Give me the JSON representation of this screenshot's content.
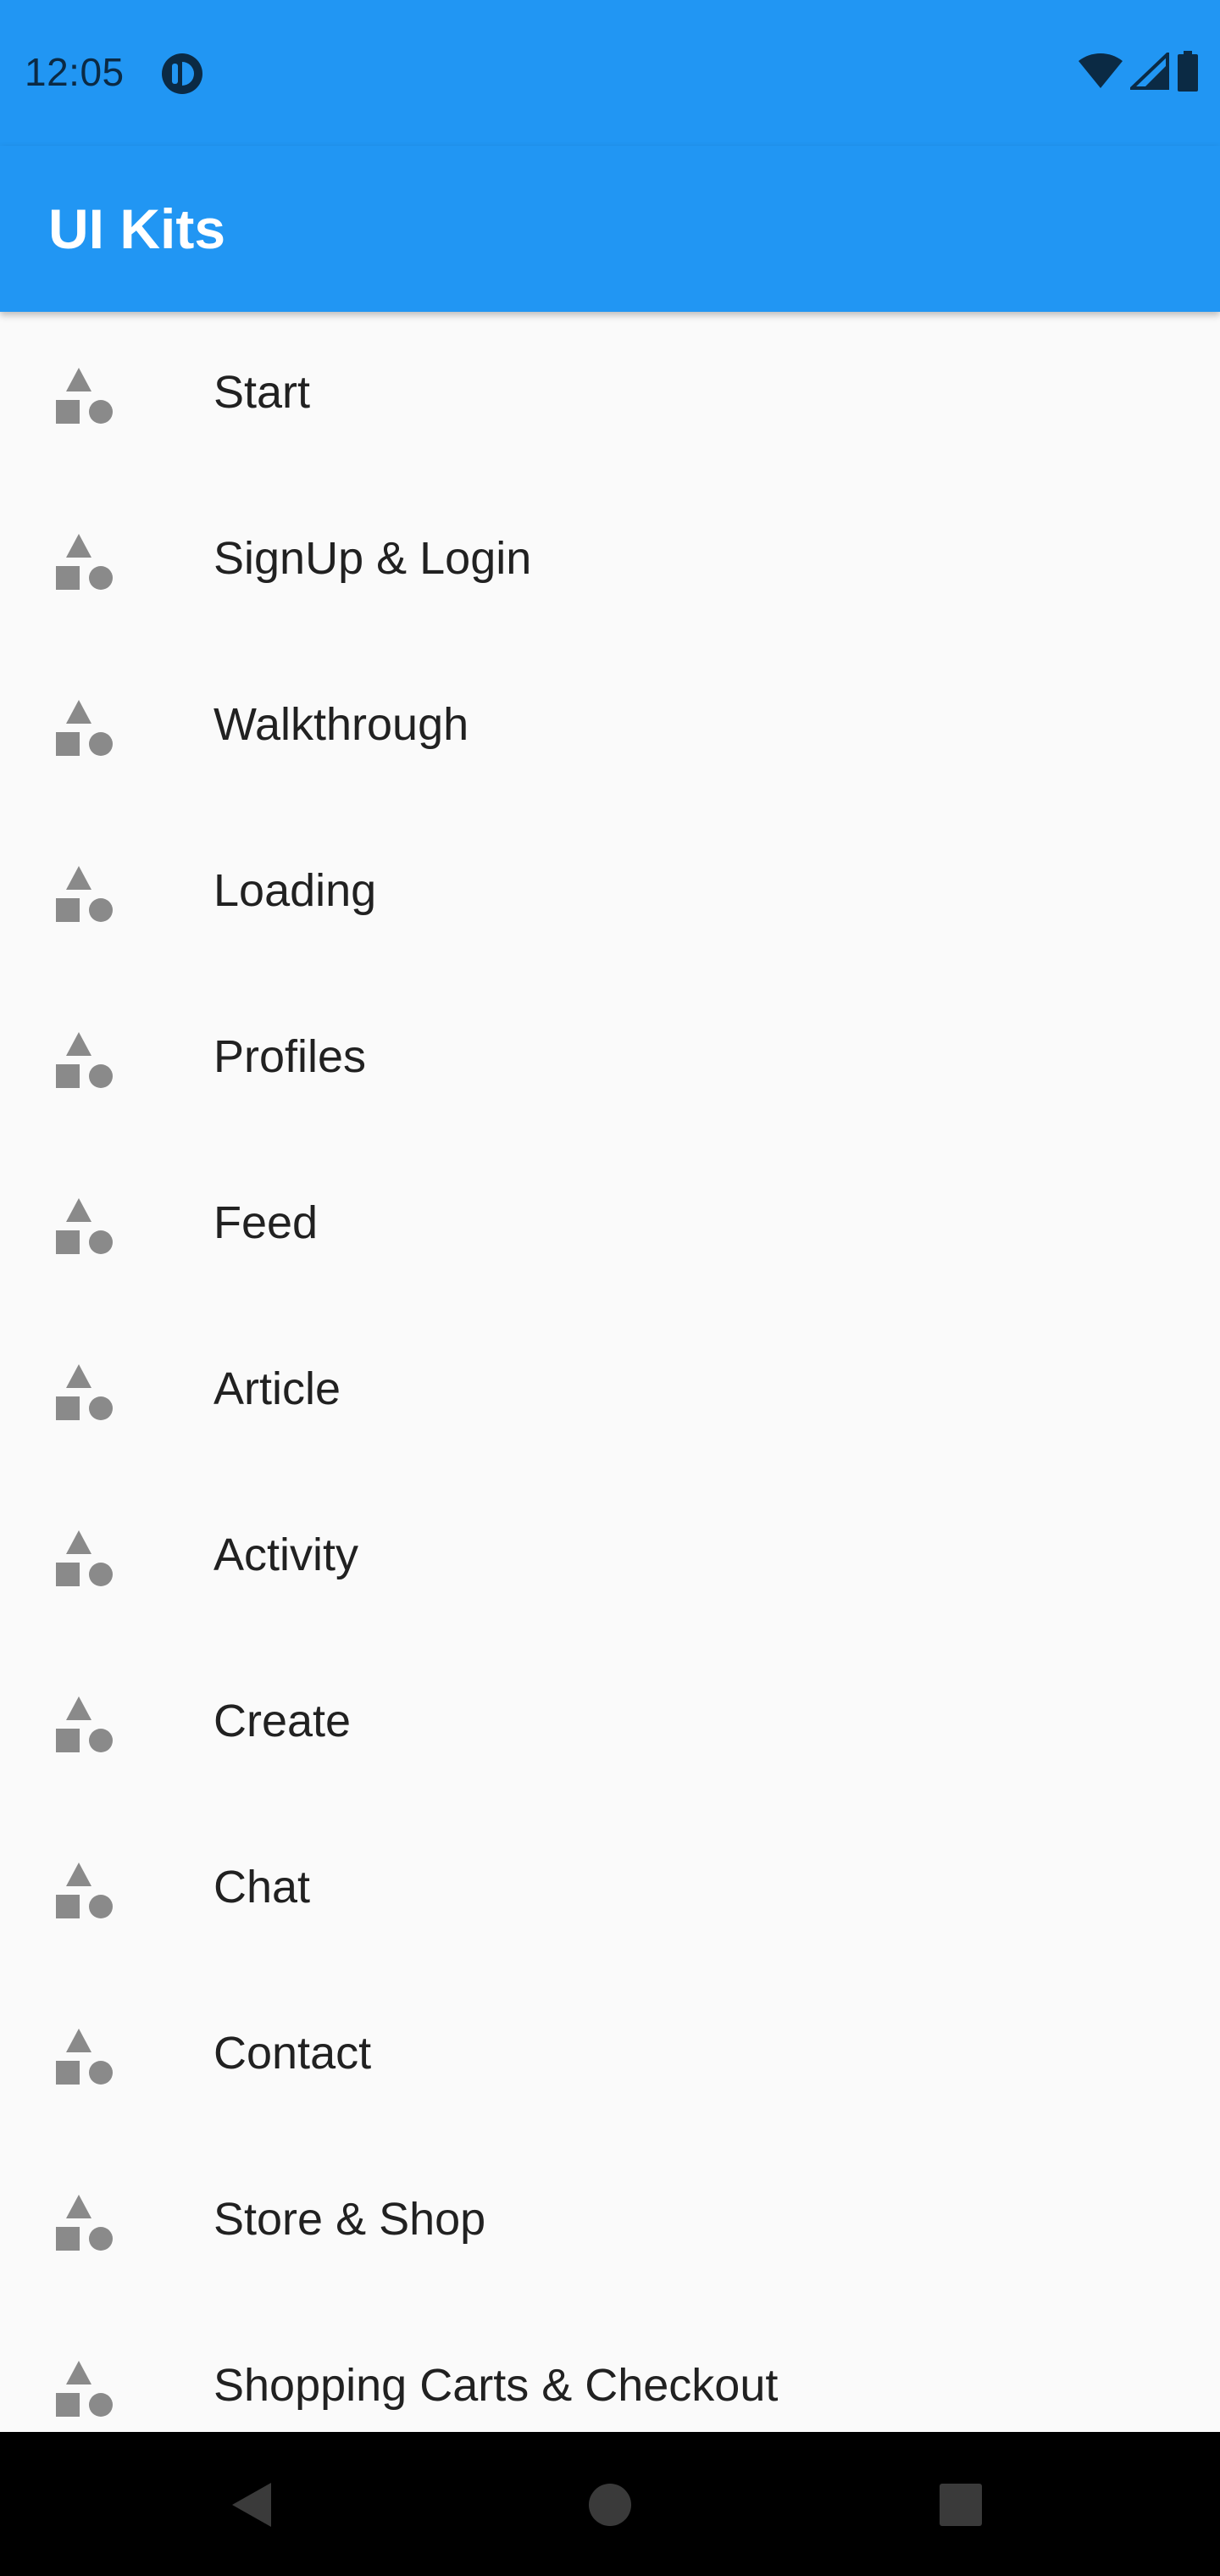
{
  "status_bar": {
    "time": "12:05",
    "app_icon": "circle-badge-icon",
    "indicators": [
      "wifi-icon",
      "signal-icon",
      "battery-icon"
    ]
  },
  "app_bar": {
    "title": "UI Kits"
  },
  "list": {
    "icon": "category-shapes-icon",
    "items": [
      {
        "label": "Start"
      },
      {
        "label": "SignUp & Login"
      },
      {
        "label": "Walkthrough"
      },
      {
        "label": "Loading"
      },
      {
        "label": "Profiles"
      },
      {
        "label": "Feed"
      },
      {
        "label": "Article"
      },
      {
        "label": "Activity"
      },
      {
        "label": "Create"
      },
      {
        "label": "Chat"
      },
      {
        "label": "Contact"
      },
      {
        "label": "Store & Shop"
      },
      {
        "label": "Shopping Carts & Checkout"
      }
    ]
  },
  "nav_bar": {
    "buttons": [
      "back-icon",
      "home-icon",
      "recents-icon"
    ]
  },
  "colors": {
    "primary": "#2196f3",
    "background": "#fafafa",
    "icon_gray": "#8a8a8a",
    "text": "#212121"
  }
}
